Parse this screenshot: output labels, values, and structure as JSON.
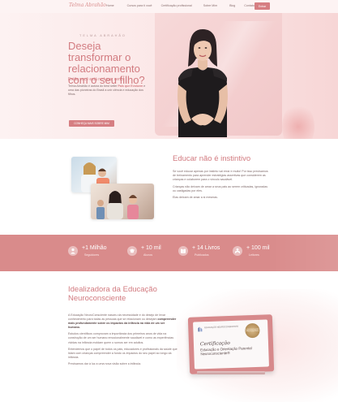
{
  "header": {
    "logo": "Telma Abrahão",
    "nav": [
      "Home",
      "Cursos para ti você",
      "Certificação profissional",
      "Sobre Mim",
      "Blog",
      "Contato"
    ],
    "cta": "Entrar"
  },
  "hero": {
    "kicker": "TELMA ABRAHÃO",
    "title": "Deseja transformar o relacionamento com o seu filho?",
    "subtitle": "Então você está no lugar certo!",
    "text_prefix": "Telma Abrahão é autora do best seller ",
    "text_highlight": "Pais que Evoluem",
    "text_suffix": " e uma das pioneiras do Brasil a unir ciência e educação dos filhos.",
    "button": "CONHEÇA MAIS SOBRE MIM"
  },
  "section2": {
    "title": "Educar não é instintivo",
    "paragraphs": [
      "Se você educar apenas por instinto vai errar e muito! Por isso precisamos de treinamento para aprender estratégias assertivas que considerem as crianças e colaborem para o vínculo saudável.",
      "Crianças não deixam de amar a seus pais ao serem criticadas, ignoradas ou castigadas por eles.",
      "Elas deixam de amar a si mesmas."
    ]
  },
  "stats": [
    {
      "value": "+1 Milhão",
      "label": "Seguidores",
      "icon": "person-icon"
    },
    {
      "value": "+ 10 mil",
      "label": "Alunos",
      "icon": "graduation-icon"
    },
    {
      "value": "+ 14 Livros",
      "label": "Publicados",
      "icon": "book-icon"
    },
    {
      "value": "+ 100 mil",
      "label": "Leitores",
      "icon": "reader-icon"
    }
  ],
  "section4": {
    "title": "Idealizadora da Educação Neuroconsciente",
    "p1_prefix": "A Educação NeuroConsciente nasceu da necessidade e do desejo de levar conhecimento para todas as pessoas que se relacionam ou desejam ",
    "p1_bold": "compreender mais profundamente sobre os impactos da infância na vida de um ser humano.",
    "p2": "Estudos científicos comprovam a importância dos primeiros anos de vida na construção de um ser humano emocionalmente saudável e como as experiências vividas na infância moldam quem o somos ser em adultos.",
    "p3": "Entendemos que o papel de todos os pais, educadores e profissionais da saúde que lidam com crianças compreender a fundo os impactos do seu papel ao longo da infância.",
    "p4": "Precisamos dar à luz a uma nova visão sobre a infância."
  },
  "certificate": {
    "logo_text": "EDUCAÇÃO NEUROCONSCIENTE",
    "seal": "CERTIFICAÇÃO PROFISSIONAL",
    "title": "Certificação",
    "subtitle": "Educação e Orientação Parental Neuroconsciente®"
  },
  "colors": {
    "accent": "#d27b80",
    "button": "#d67e82",
    "stats_band": "#d98b8b"
  }
}
